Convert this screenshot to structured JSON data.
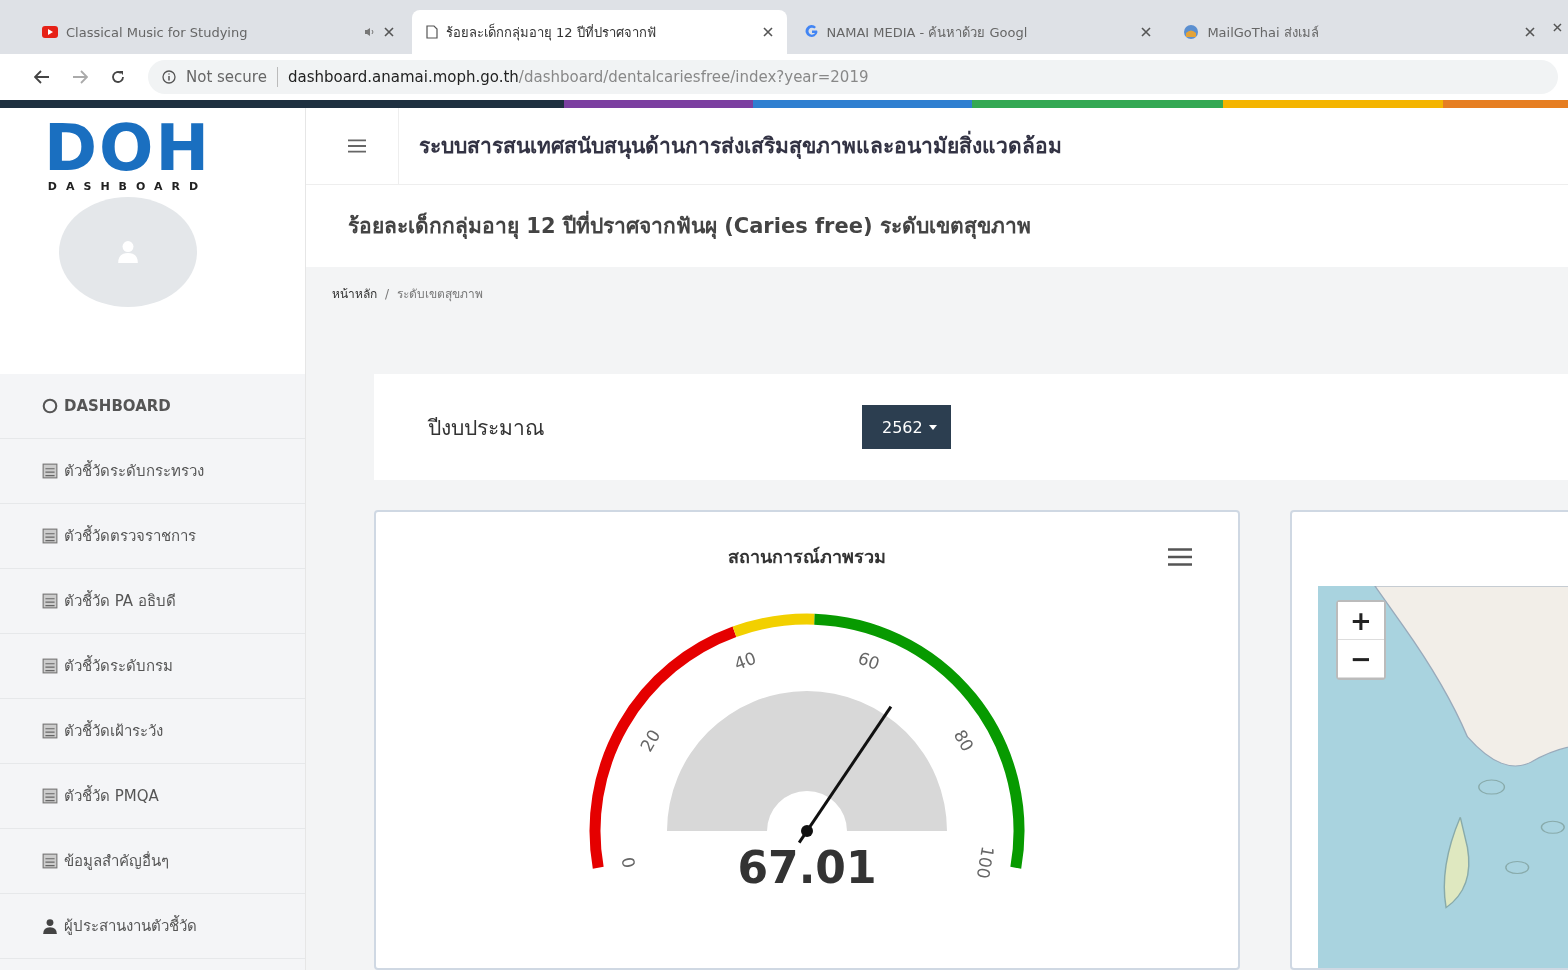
{
  "browser": {
    "tabs": [
      {
        "kind": "video",
        "label": "Classical Music for Studying",
        "audio": true,
        "selected": false
      },
      {
        "kind": "page",
        "label": "ร้อยละเด็กกลุ่มอายุ 12 ปีที่ปราศจากฟั",
        "audio": false,
        "selected": true
      },
      {
        "kind": "google",
        "label": "NAMAI MEDIA - ค้นหาด้วย Googl",
        "audio": false,
        "selected": false
      },
      {
        "kind": "mail",
        "label": "MailGoThai ส่งเมล์",
        "audio": false,
        "selected": false
      }
    ],
    "security": "Not secure",
    "url_host": "dashboard.anamai.moph.go.th",
    "url_path": "/dashboard/dentalcariesfree/index?year=2019"
  },
  "logo": {
    "text": "DOH",
    "subtitle": "DASHBOARD"
  },
  "sidebar": {
    "items": [
      {
        "kind": "circle",
        "label": "DASHBOARD"
      },
      {
        "kind": "table",
        "label": "ตัวชี้วัดระดับกระทรวง"
      },
      {
        "kind": "table",
        "label": "ตัวชี้วัดตรวจราชการ"
      },
      {
        "kind": "table",
        "label": "ตัวชี้วัด PA อธิบดี"
      },
      {
        "kind": "table",
        "label": "ตัวชี้วัดระดับกรม"
      },
      {
        "kind": "table",
        "label": "ตัวชี้วัดเฝ้าระวัง"
      },
      {
        "kind": "table",
        "label": "ตัวชี้วัด PMQA"
      },
      {
        "kind": "table",
        "label": "ข้อมูลสำคัญอื่นๆ"
      },
      {
        "kind": "user",
        "label": "ผู้ประสานงานตัวชี้วัด"
      }
    ]
  },
  "header": {
    "title": "ระบบสารสนเทศสนับสนุนด้านการส่งเสริมสุขภาพและอนามัยสิ่งแวดล้อม"
  },
  "page_title": "ร้อยละเด็กกลุ่มอายุ 12 ปีที่ปราศจากฟันผุ (Caries free) ระดับเขตสุขภาพ",
  "breadcrumb": {
    "separator": "/",
    "items": [
      "หน้าหลัก",
      "ระดับเขตสุขภาพ"
    ]
  },
  "filter": {
    "label": "ปีงบประมาณ",
    "value": "2562"
  },
  "gauge_card": {
    "title": "สถานการณ์ภาพรวม",
    "level": 0.6701,
    "reading": "67.01",
    "ticks": [
      "0",
      "20",
      "40",
      "60",
      "80",
      "100"
    ]
  },
  "map": {
    "zoom_in": "+",
    "zoom_out": "−"
  }
}
